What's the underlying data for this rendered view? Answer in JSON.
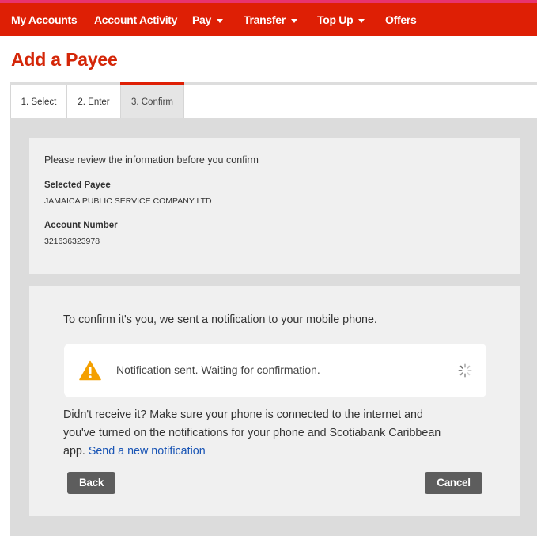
{
  "nav": {
    "items": [
      {
        "label": "My Accounts",
        "has_caret": false
      },
      {
        "label": "Account Activity",
        "has_caret": false
      },
      {
        "label": "Pay",
        "has_caret": true
      },
      {
        "label": "Transfer",
        "has_caret": true
      },
      {
        "label": "Top Up",
        "has_caret": true
      },
      {
        "label": "Offers",
        "has_caret": false
      }
    ]
  },
  "page": {
    "title": "Add a Payee"
  },
  "steps": {
    "tabs": [
      {
        "label": "1. Select",
        "active": false
      },
      {
        "label": "2. Enter",
        "active": false
      },
      {
        "label": "3. Confirm",
        "active": true
      }
    ]
  },
  "review": {
    "intro": "Please review the information before you confirm",
    "payee_label": "Selected Payee",
    "payee_value": "JAMAICA PUBLIC SERVICE COMPANY LTD",
    "account_label": "Account Number",
    "account_value": "321636323978"
  },
  "confirm": {
    "message": "To confirm it's you, we sent a notification to your mobile phone.",
    "status_icon": "warning-icon",
    "status_text": "Notification sent. Waiting for confirmation.",
    "loading_icon": "spinner-icon",
    "help_line1": "Didn't receive it? Make sure your phone is connected to the internet and",
    "help_line2": "you've turned on the notifications for your phone and Scotiabank Caribbean",
    "help_line3": "app.",
    "resend_link": "Send a new notification",
    "back_label": "Back",
    "cancel_label": "Cancel"
  },
  "colors": {
    "brand_red": "#de1f05",
    "top_stripe": "#e8336f",
    "title_red": "#d42608",
    "link_blue": "#1a55b5",
    "warning_orange": "#f4a000",
    "button_gray": "#5d5d5d"
  }
}
